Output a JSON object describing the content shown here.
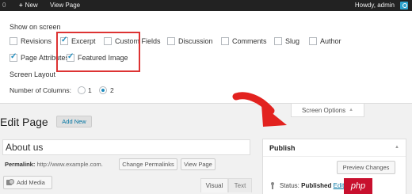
{
  "admin_bar": {
    "count": "0",
    "new_label": "New",
    "view_page_label": "View Page",
    "howdy": "Howdy, admin"
  },
  "screen_options": {
    "show_on_screen_title": "Show on screen",
    "checkboxes": [
      {
        "label": "Revisions",
        "checked": false
      },
      {
        "label": "Excerpt",
        "checked": true
      },
      {
        "label": "Custom Fields",
        "checked": false
      },
      {
        "label": "Discussion",
        "checked": false
      },
      {
        "label": "Comments",
        "checked": false
      },
      {
        "label": "Slug",
        "checked": false
      },
      {
        "label": "Author",
        "checked": false
      },
      {
        "label": "Page Attributes",
        "checked": true
      },
      {
        "label": "Featured Image",
        "checked": true
      }
    ],
    "layout_title": "Screen Layout",
    "columns_label": "Number of Columns:",
    "column_options": [
      "1",
      "2"
    ],
    "selected_columns": "2",
    "tab_label": "Screen Options"
  },
  "editor": {
    "page_title": "Edit Page",
    "add_new_label": "Add New",
    "title_value": "About us",
    "permalink_label": "Permalink:",
    "permalink_url": "http://www.example.com.",
    "change_permalinks_label": "Change Permalinks",
    "view_page_label": "View Page",
    "add_media_label": "Add Media",
    "tabs": [
      "Visual",
      "Text"
    ]
  },
  "publish": {
    "title": "Publish",
    "preview_label": "Preview Changes",
    "status_label": "Status:",
    "status_value": "Published",
    "edit_label": "Edit"
  },
  "watermark": "php",
  "colors": {
    "highlight": "#dd3333",
    "arrow": "#e2221f",
    "admin_bar": "#222222",
    "link": "#0074a2"
  }
}
